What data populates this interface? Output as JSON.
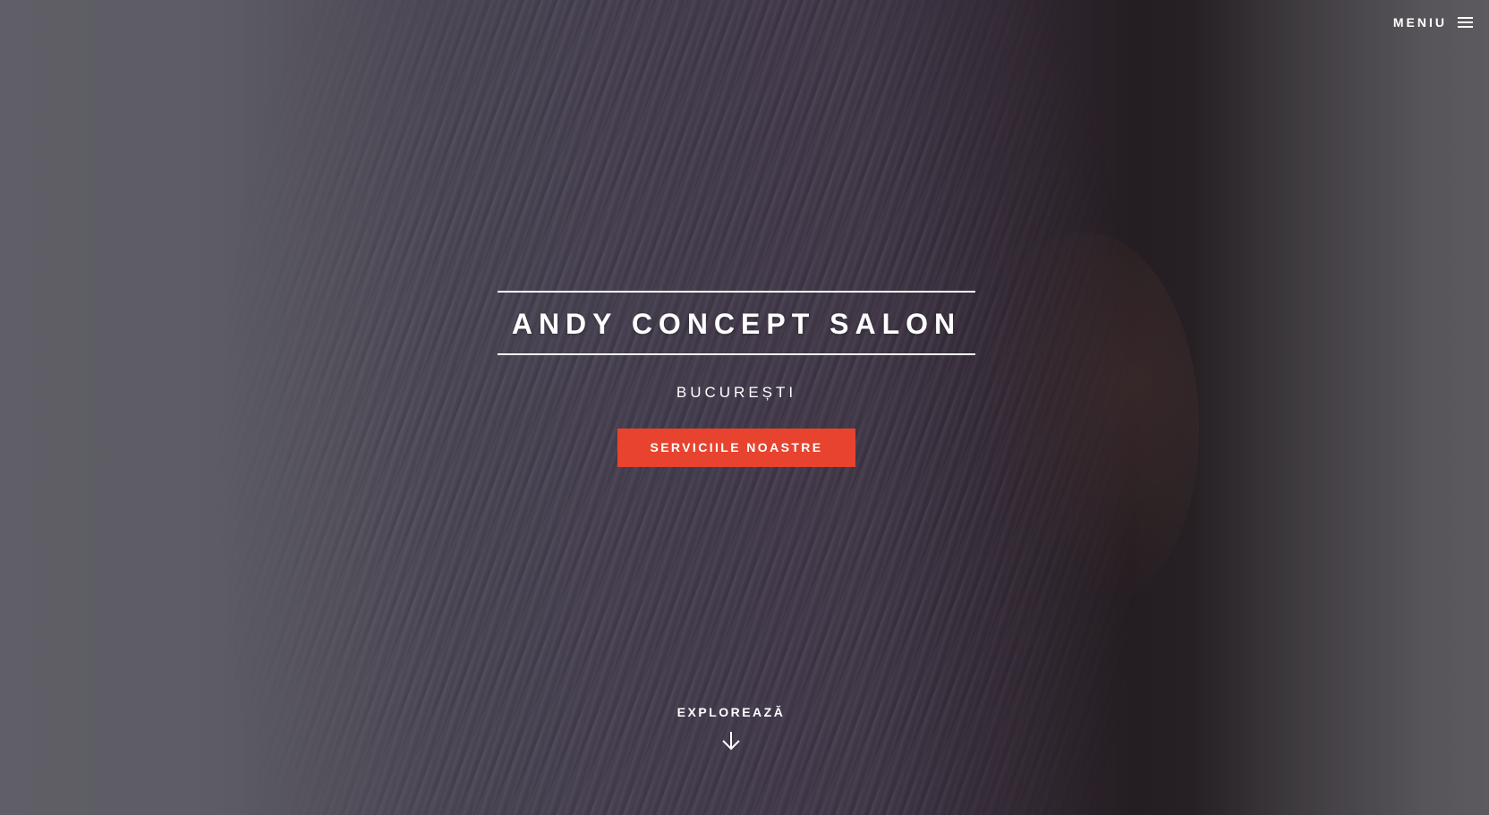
{
  "header": {
    "menu_label": "MENIU",
    "menu_icon": "hamburger-icon"
  },
  "hero": {
    "title": "ANDY CONCEPT SALON",
    "subtitle": "BUCUREȘTI",
    "cta_label": "SERVICIILE NOASTRE",
    "explore_label": "EXPLOREAZĂ",
    "explore_icon": "arrow-down-icon"
  },
  "colors": {
    "accent": "#e8432e",
    "text": "#ffffff"
  }
}
